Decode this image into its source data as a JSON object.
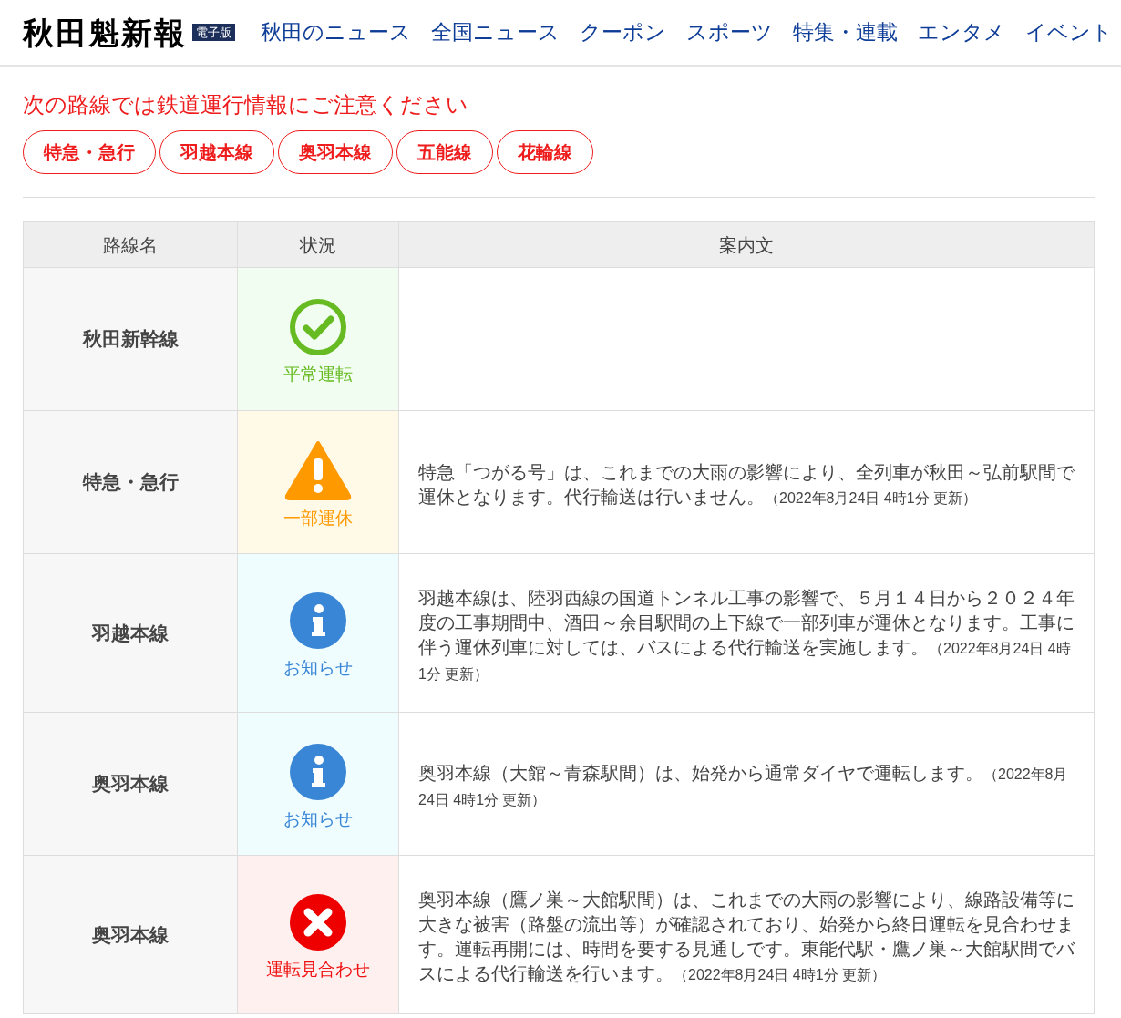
{
  "header": {
    "logo": "秋田魁新報",
    "edition_badge": "電子版",
    "nav": [
      "秋田のニュース",
      "全国ニュース",
      "クーポン",
      "スポーツ",
      "特集・連載",
      "エンタメ",
      "イベント"
    ]
  },
  "alert": {
    "title": "次の路線では鉄道運行情報にご注意ください",
    "lines": [
      "特急・急行",
      "羽越本線",
      "奥羽本線",
      "五能線",
      "花輪線"
    ]
  },
  "table": {
    "columns": [
      "路線名",
      "状況",
      "案内文"
    ],
    "rows": [
      {
        "line": "秋田新幹線",
        "status": {
          "kind": "normal",
          "label": "平常運転"
        }
      },
      {
        "line": "特急・急行",
        "status": {
          "kind": "partial",
          "label": "一部運休"
        },
        "notice": "特急「つがる号」は、これまでの大雨の影響により、全列車が秋田～弘前駅間で運休となります。代行輸送は行いません。",
        "updated": "（2022年8月24日 4時1分 更新）"
      },
      {
        "line": "羽越本線",
        "status": {
          "kind": "info",
          "label": "お知らせ"
        },
        "notice": "羽越本線は、陸羽西線の国道トンネル工事の影響で、５月１４日から２０２４年度の工事期間中、酒田～余目駅間の上下線で一部列車が運休となります。工事に伴う運休列車に対しては、バスによる代行輸送を実施します。",
        "updated": "（2022年8月24日 4時1分 更新）"
      },
      {
        "line": "奥羽本線",
        "status": {
          "kind": "info",
          "label": "お知らせ"
        },
        "notice": "奥羽本線（大館～青森駅間）は、始発から通常ダイヤで運転します。",
        "updated": "（2022年8月24日 4時1分 更新）"
      },
      {
        "line": "奥羽本線",
        "status": {
          "kind": "suspended",
          "label": "運転見合わせ"
        },
        "notice": "奥羽本線（鷹ノ巣～大館駅間）は、これまでの大雨の影響により、線路設備等に大きな被害（路盤の流出等）が確認されており、始発から終日運転を見合わせます。運転再開には、時間を要する見通しです。東能代駅・鷹ノ巣～大館駅間でバスによる代行輸送を行います。",
        "updated": "（2022年8月24日 4時1分 更新）"
      }
    ]
  }
}
